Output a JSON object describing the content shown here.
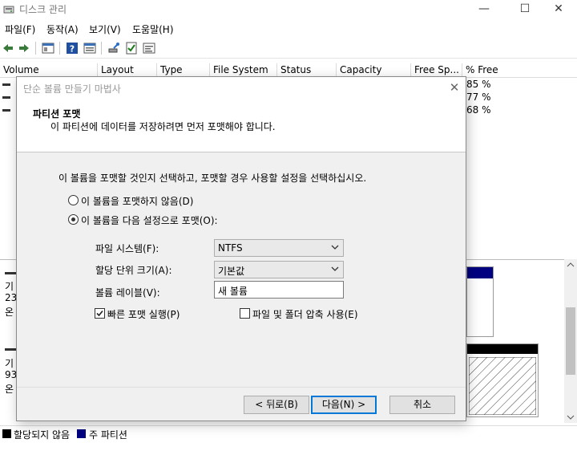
{
  "window": {
    "title": "디스크 관리",
    "minimize_glyph": "—",
    "maximize_glyph": "☐",
    "close_glyph": "✕"
  },
  "menu": [
    "파일(F)",
    "동작(A)",
    "보기(V)",
    "도움말(H)"
  ],
  "toolbar_icons": [
    "back-icon",
    "forward-icon",
    "properties-icon",
    "help-icon",
    "list-view-icon",
    "connect-disk-icon",
    "checklist-icon",
    "console-icon"
  ],
  "volume_columns": [
    "Volume",
    "Layout",
    "Type",
    "File System",
    "Status",
    "Capacity",
    "Free Sp...",
    "% Free"
  ],
  "volume_free_pct": [
    "85 %",
    "77 %",
    "68 %"
  ],
  "lower_pane": {
    "disk0_lines": [
      "기",
      "23",
      "온"
    ],
    "disk1_lines": [
      "기",
      "93",
      "온"
    ]
  },
  "legend": {
    "unallocated": "할당되지 않음",
    "primary": "주 파티션",
    "unallocated_color": "#000000",
    "primary_color": "#000080"
  },
  "wizard": {
    "title": "단순 볼륨 만들기 마법사",
    "close_glyph": "✕",
    "heading": "파티션 포맷",
    "subheading": "이 파티션에 데이터를 저장하려면 먼저 포맷해야 합니다.",
    "instruction": "이 볼륨을 포맷할 것인지 선택하고, 포맷할 경우 사용할 설정을 선택하십시오.",
    "option_no_format": "이 볼륨을 포맷하지 않음(D)",
    "option_format": "이 볼륨을 다음 설정으로 포맷(O):",
    "selected_option": "format",
    "file_system_label": "파일 시스템(F):",
    "file_system_value": "NTFS",
    "alloc_label": "할당 단위 크기(A):",
    "alloc_value": "기본값",
    "volume_label_label": "볼륨 레이블(V):",
    "volume_label_value": "새 볼륨",
    "quick_format_label": "빠른 포맷 실행(P)",
    "quick_format_checked": true,
    "compression_label": "파일 및 폴더 압축 사용(E)",
    "compression_checked": false,
    "back_button": "< 뒤로(B)",
    "next_button": "다음(N) >",
    "cancel_button": "취소"
  },
  "colors": {
    "accent": "#0078d7",
    "dialog_bg": "#f0f0f0",
    "primary_partition": "#000080"
  }
}
